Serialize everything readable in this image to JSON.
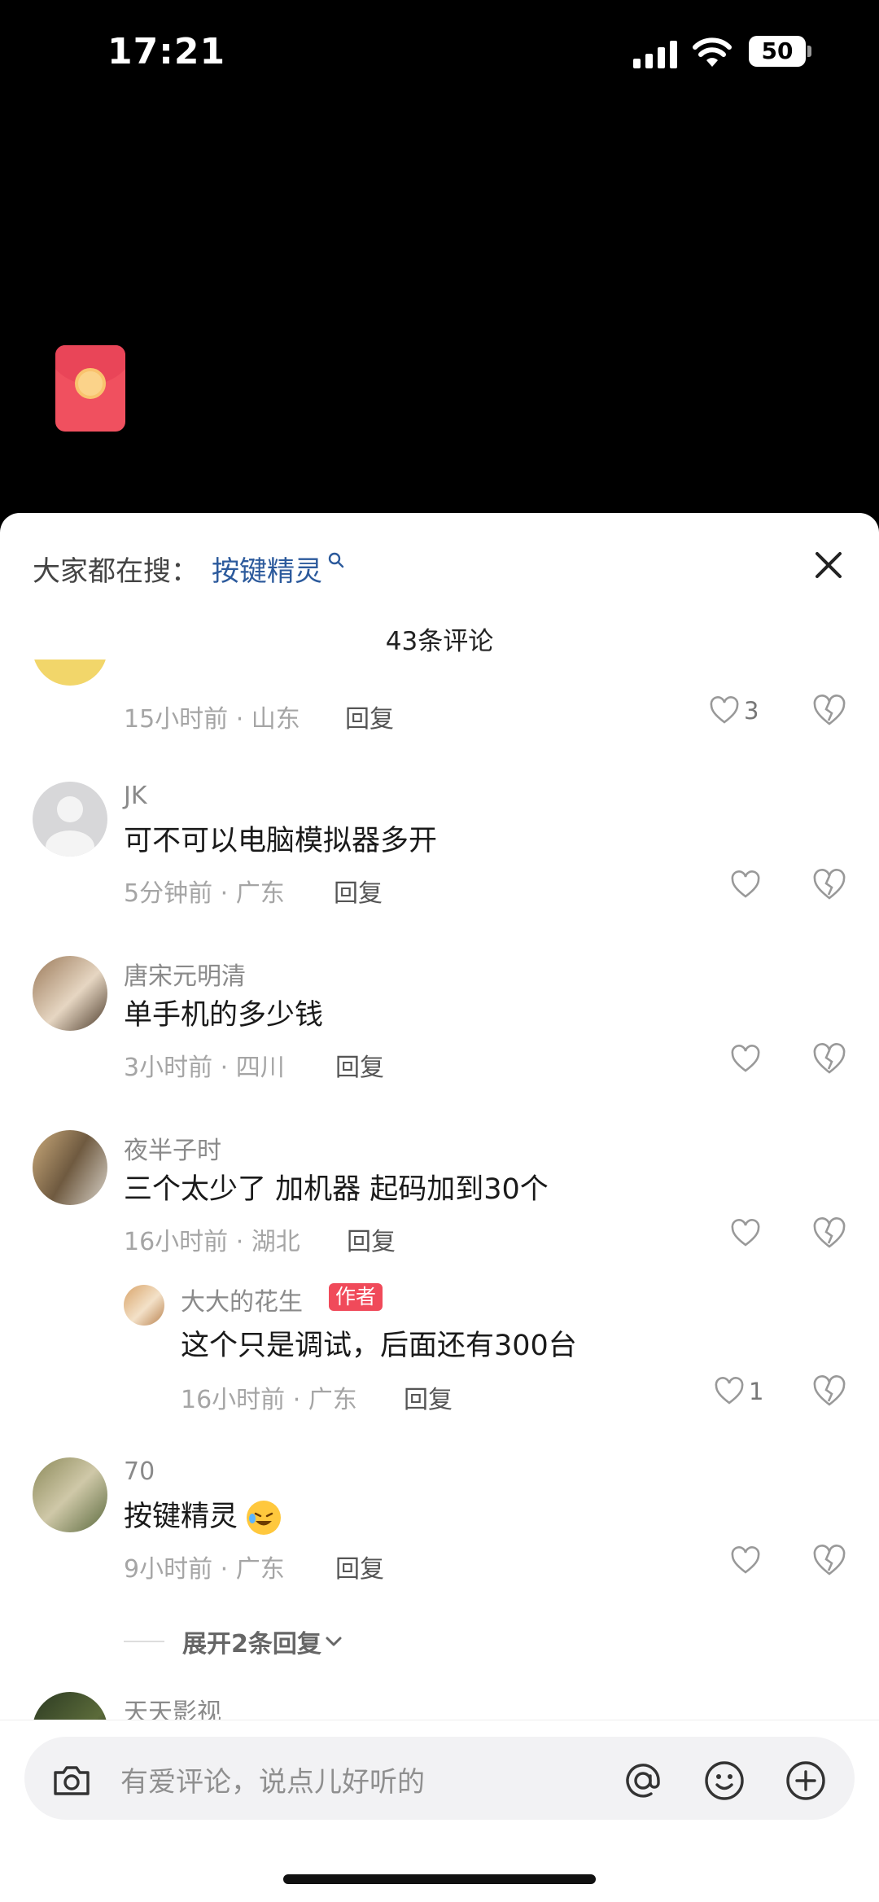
{
  "status_bar": {
    "time": "17:21",
    "battery": "50"
  },
  "search_suggest": {
    "prefix": "大家都在搜：",
    "term": "按键精灵"
  },
  "comment_count": "43条评论",
  "partial_comment": {
    "meta": "15小时前 · 山东",
    "reply": "回复",
    "likes": "3"
  },
  "comments": [
    {
      "user": "JK",
      "text": "可不可以电脑模拟器多开",
      "meta": "5分钟前 · 广东",
      "reply": "回复",
      "likes": ""
    },
    {
      "user": "唐宋元明清",
      "text": "单手机的多少钱",
      "meta": "3小时前 · 四川",
      "reply": "回复",
      "likes": ""
    },
    {
      "user": "夜半子时",
      "text": "三个太少了 加机器 起码加到30个",
      "meta": "16小时前 · 湖北",
      "reply": "回复",
      "likes": ""
    },
    {
      "user": "70",
      "text": "按键精灵",
      "meta": "9小时前 · 广东",
      "reply": "回复",
      "likes": ""
    },
    {
      "user": "天天影视"
    }
  ],
  "sub_reply": {
    "user": "大大的花生",
    "badge": "作者",
    "text": "这个只是调试，后面还有300台",
    "meta": "16小时前 · 广东",
    "reply": "回复",
    "likes": "1"
  },
  "expand_replies": "展开2条回复",
  "input": {
    "placeholder": "有爱评论，说点儿好听的"
  },
  "icons": [
    "signal-icon",
    "wifi-icon",
    "battery-icon",
    "red-envelope-icon",
    "close-icon",
    "search-icon",
    "heart-icon",
    "broken-heart-icon",
    "camera-icon",
    "at-icon",
    "emoji-icon",
    "plus-icon",
    "chevron-down-icon"
  ],
  "colors": {
    "accent_link": "#2c5a9c",
    "author_badge": "#f04a5a",
    "red_envelope": "#f0505f"
  }
}
